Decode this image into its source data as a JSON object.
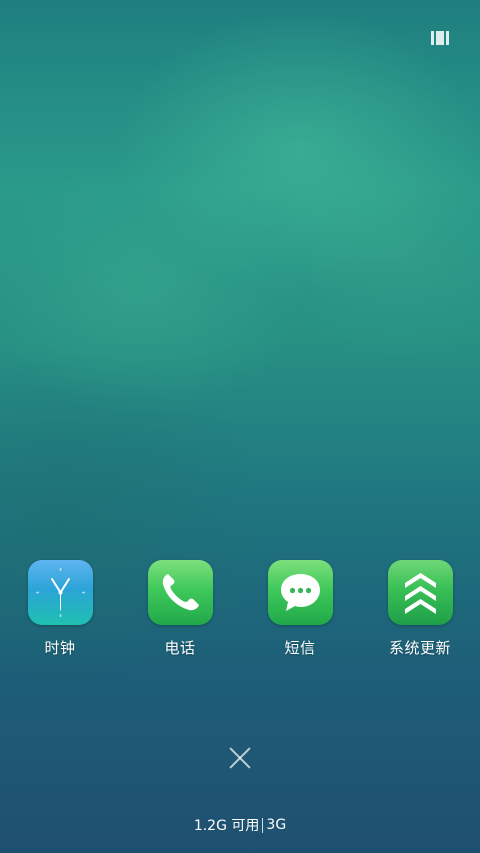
{
  "top_bar": {
    "recent_icon": "recent-apps-icon"
  },
  "apps": [
    {
      "label": "时钟",
      "icon": "clock-icon"
    },
    {
      "label": "电话",
      "icon": "phone-icon"
    },
    {
      "label": "短信",
      "icon": "message-icon"
    },
    {
      "label": "系统更新",
      "icon": "system-update-icon"
    }
  ],
  "close": {
    "icon": "close-icon"
  },
  "status": {
    "available_memory": "1.2G 可用",
    "network": "3G"
  }
}
